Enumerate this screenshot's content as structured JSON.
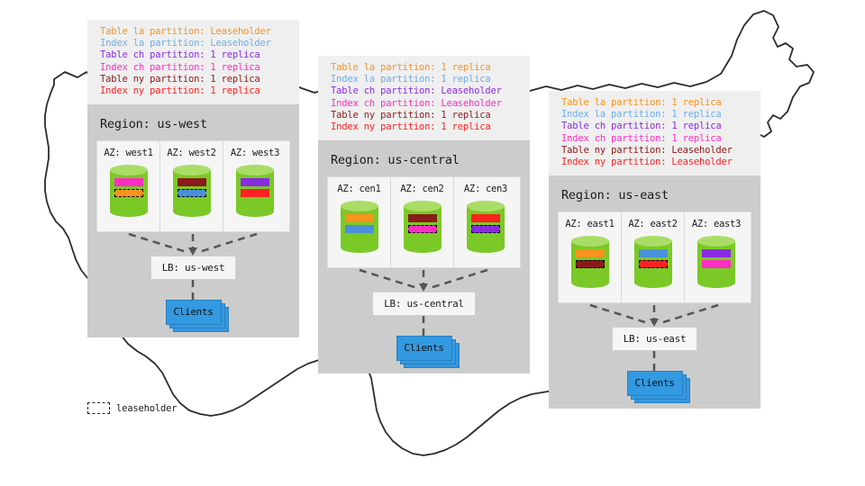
{
  "legend": {
    "swatch_icon": "dashed-rect-icon",
    "label": "leaseholder"
  },
  "map": {
    "name": "united-states-outline",
    "stroke": "#1a1a1a"
  },
  "colors": {
    "la_table": "#F7941E",
    "la_index": "#6BAEE8",
    "ch_table": "#8A2BE2",
    "ch_index": "#FF2EC4",
    "ny_table": "#8B1A1A",
    "ny_index": "#FF2020",
    "cylinder_body": "#7AC926",
    "cylinder_top": "#AADD66",
    "clients_box": "#3399E0",
    "region_panel": "#CCCCCC",
    "info_panel": "#EFEFEF",
    "az_panel": "#F5F5F5"
  },
  "regions": [
    {
      "id": "us-west",
      "region_title": "Region: us-west",
      "info_lines": [
        {
          "text": "Table la partition: Leaseholder",
          "color": "#F7941E"
        },
        {
          "text": "Index la partition: Leaseholder",
          "color": "#6BAEE8"
        },
        {
          "text": "Table ch partition: 1 replica",
          "color": "#8A2BE2"
        },
        {
          "text": "Index ch partition: 1 replica",
          "color": "#FF2EC4"
        },
        {
          "text": "Table ny partition: 1 replica",
          "color": "#8B1A1A"
        },
        {
          "text": "Index ny partition: 1 replica",
          "color": "#FF2020"
        }
      ],
      "azs": [
        {
          "label": "AZ: west1",
          "bars": [
            {
              "color": "#FF2EC4",
              "leaseholder": false
            },
            {
              "color": "#F7941E",
              "leaseholder": true
            }
          ]
        },
        {
          "label": "AZ: west2",
          "bars": [
            {
              "color": "#8B1A1A",
              "leaseholder": false
            },
            {
              "color": "#4A90D9",
              "leaseholder": true
            }
          ]
        },
        {
          "label": "AZ: west3",
          "bars": [
            {
              "color": "#8A2BE2",
              "leaseholder": false
            },
            {
              "color": "#FF2020",
              "leaseholder": false
            }
          ]
        }
      ],
      "lb_label": "LB: us-west",
      "clients_label": "Clients"
    },
    {
      "id": "us-central",
      "region_title": "Region: us-central",
      "info_lines": [
        {
          "text": "Table la partition: 1 replica",
          "color": "#F7941E"
        },
        {
          "text": "Index la partition: 1 replica",
          "color": "#6BAEE8"
        },
        {
          "text": "Table ch partition: Leaseholder",
          "color": "#8A2BE2"
        },
        {
          "text": "Index ch partition: Leaseholder",
          "color": "#FF2EC4"
        },
        {
          "text": "Table ny partition: 1 replica",
          "color": "#8B1A1A"
        },
        {
          "text": "Index ny partition: 1 replica",
          "color": "#FF2020"
        }
      ],
      "azs": [
        {
          "label": "AZ: cen1",
          "bars": [
            {
              "color": "#F7941E",
              "leaseholder": false
            },
            {
              "color": "#4A90D9",
              "leaseholder": false
            }
          ]
        },
        {
          "label": "AZ: cen2",
          "bars": [
            {
              "color": "#8B1A1A",
              "leaseholder": false
            },
            {
              "color": "#FF2EC4",
              "leaseholder": true
            }
          ]
        },
        {
          "label": "AZ: cen3",
          "bars": [
            {
              "color": "#FF2020",
              "leaseholder": false
            },
            {
              "color": "#8A2BE2",
              "leaseholder": true
            }
          ]
        }
      ],
      "lb_label": "LB: us-central",
      "clients_label": "Clients"
    },
    {
      "id": "us-east",
      "region_title": "Region: us-east",
      "info_lines": [
        {
          "text": "Table la partition: 1 replica",
          "color": "#F7941E"
        },
        {
          "text": "Index la partition: 1 replica",
          "color": "#6BAEE8"
        },
        {
          "text": "Table ch partition: 1 replica",
          "color": "#8A2BE2"
        },
        {
          "text": "Index ch partition: 1 replica",
          "color": "#FF2EC4"
        },
        {
          "text": "Table ny partition: Leaseholder",
          "color": "#8B1A1A"
        },
        {
          "text": "Index ny partition: Leaseholder",
          "color": "#FF2020"
        }
      ],
      "azs": [
        {
          "label": "AZ: east1",
          "bars": [
            {
              "color": "#F7941E",
              "leaseholder": false
            },
            {
              "color": "#8B1A1A",
              "leaseholder": true
            }
          ]
        },
        {
          "label": "AZ: east2",
          "bars": [
            {
              "color": "#4A90D9",
              "leaseholder": false
            },
            {
              "color": "#FF2020",
              "leaseholder": true
            }
          ]
        },
        {
          "label": "AZ: east3",
          "bars": [
            {
              "color": "#8A2BE2",
              "leaseholder": false
            },
            {
              "color": "#FF2EC4",
              "leaseholder": false
            }
          ]
        }
      ],
      "lb_label": "LB: us-east",
      "clients_label": "Clients"
    }
  ]
}
